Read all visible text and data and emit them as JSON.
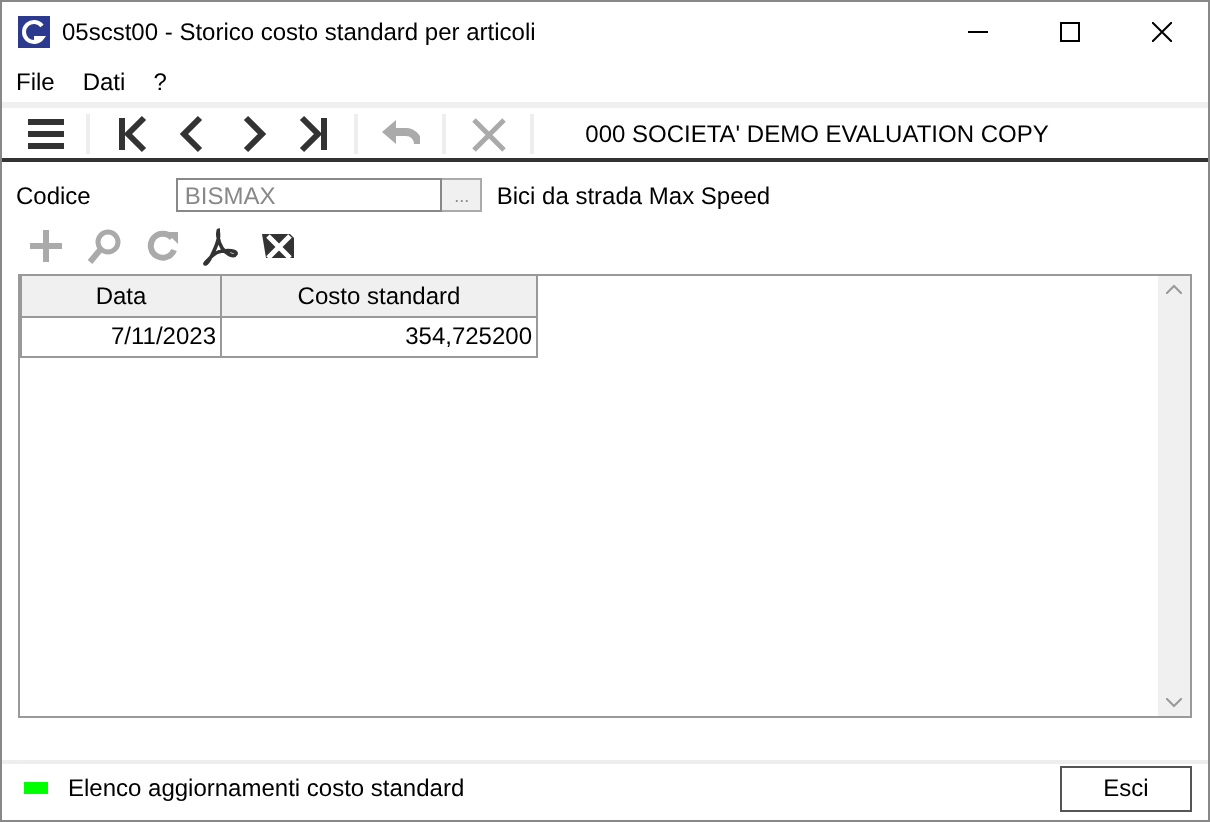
{
  "window": {
    "title": "05scst00 - Storico costo standard per articoli"
  },
  "menu": [
    "File",
    "Dati",
    "?"
  ],
  "toolbar": [
    {
      "kind": "menu",
      "disabled": false
    },
    {
      "kind": "first",
      "disabled": false
    },
    {
      "kind": "prev",
      "disabled": false
    },
    {
      "kind": "next",
      "disabled": false
    },
    {
      "kind": "last",
      "disabled": false
    },
    {
      "kind": "undo",
      "disabled": true
    },
    {
      "kind": "cancel",
      "disabled": true
    }
  ],
  "company": "000 SOCIETA'  DEMO EVALUATION COPY",
  "codice": {
    "label": "Codice",
    "value": "BISMAX",
    "lookup": "...",
    "description": "Bici da strada Max Speed"
  },
  "actions": [
    {
      "kind": "add",
      "disabled": true
    },
    {
      "kind": "search",
      "disabled": true
    },
    {
      "kind": "refresh",
      "disabled": true
    },
    {
      "kind": "pdf",
      "disabled": false
    },
    {
      "kind": "excel",
      "disabled": false
    }
  ],
  "table": {
    "columns": [
      "Data",
      "Costo standard"
    ],
    "rows": [
      [
        "7/11/2023",
        "354,725200"
      ]
    ]
  },
  "status_bar": {
    "color": "#00ff00",
    "text": "Elenco aggiornamenti costo standard"
  },
  "buttons": [
    "Esci"
  ]
}
